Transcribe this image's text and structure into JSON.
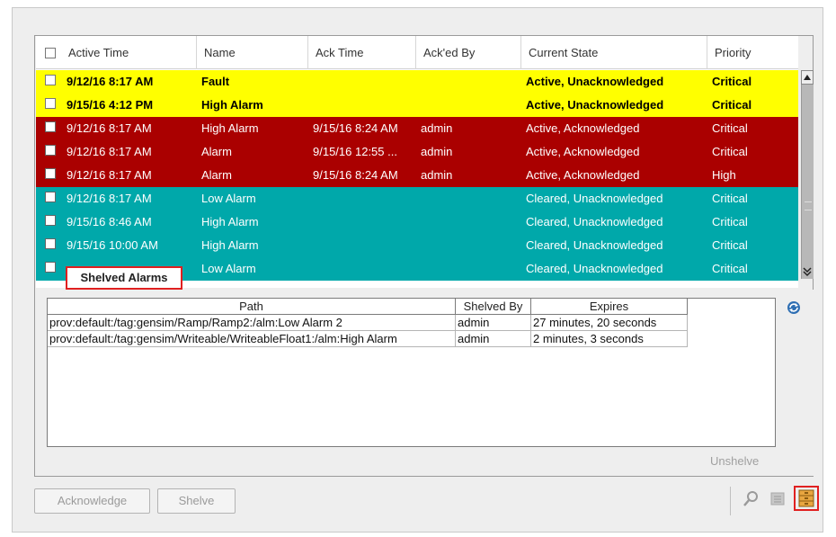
{
  "columns": [
    "Active Time",
    "Name",
    "Ack Time",
    "Ack'ed By",
    "Current State",
    "Priority"
  ],
  "rows": [
    {
      "active": "9/12/16 8:17 AM",
      "name": "Fault",
      "ack_time": "",
      "acked_by": "",
      "state": "Active, Unacknowledged",
      "priority": "Critical",
      "color": "yellow"
    },
    {
      "active": "9/15/16 4:12 PM",
      "name": "High Alarm",
      "ack_time": "",
      "acked_by": "",
      "state": "Active, Unacknowledged",
      "priority": "Critical",
      "color": "yellow"
    },
    {
      "active": "9/12/16 8:17 AM",
      "name": "High Alarm",
      "ack_time": "9/15/16 8:24 AM",
      "acked_by": "admin",
      "state": "Active, Acknowledged",
      "priority": "Critical",
      "color": "red"
    },
    {
      "active": "9/12/16 8:17 AM",
      "name": "Alarm",
      "ack_time": "9/15/16 12:55 ...",
      "acked_by": "admin",
      "state": "Active, Acknowledged",
      "priority": "Critical",
      "color": "red"
    },
    {
      "active": "9/12/16 8:17 AM",
      "name": "Alarm",
      "ack_time": "9/15/16 8:24 AM",
      "acked_by": "admin",
      "state": "Active, Acknowledged",
      "priority": "High",
      "color": "red"
    },
    {
      "active": "9/12/16 8:17 AM",
      "name": "Low Alarm",
      "ack_time": "",
      "acked_by": "",
      "state": "Cleared, Unacknowledged",
      "priority": "Critical",
      "color": "teal"
    },
    {
      "active": "9/15/16 8:46 AM",
      "name": "High Alarm",
      "ack_time": "",
      "acked_by": "",
      "state": "Cleared, Unacknowledged",
      "priority": "Critical",
      "color": "teal"
    },
    {
      "active": "9/15/16 10:00 AM",
      "name": "High Alarm",
      "ack_time": "",
      "acked_by": "",
      "state": "Cleared, Unacknowledged",
      "priority": "Critical",
      "color": "teal"
    },
    {
      "active": "",
      "name": "Low Alarm",
      "ack_time": "",
      "acked_by": "",
      "state": "Cleared, Unacknowledged",
      "priority": "Critical",
      "color": "teal"
    }
  ],
  "colors": {
    "yellow": "#ffff00",
    "red": "#aa0000",
    "teal": "#00a8aa",
    "highlight": "#e02020"
  },
  "shelved": {
    "tab_label": "Shelved Alarms",
    "columns": [
      "Path",
      "Shelved By",
      "Expires"
    ],
    "rows": [
      {
        "path": "prov:default:/tag:gensim/Ramp/Ramp2:/alm:Low Alarm 2",
        "by": "admin",
        "expires": "27 minutes, 20 seconds"
      },
      {
        "path": "prov:default:/tag:gensim/Writeable/WriteableFloat1:/alm:High Alarm",
        "by": "admin",
        "expires": "2 minutes, 3 seconds"
      }
    ],
    "unshelve_label": "Unshelve"
  },
  "buttons": {
    "acknowledge": "Acknowledge",
    "shelve": "Shelve"
  },
  "icons": [
    "refresh-icon",
    "magnifier-icon",
    "filter-icon",
    "shelved-view-icon"
  ]
}
